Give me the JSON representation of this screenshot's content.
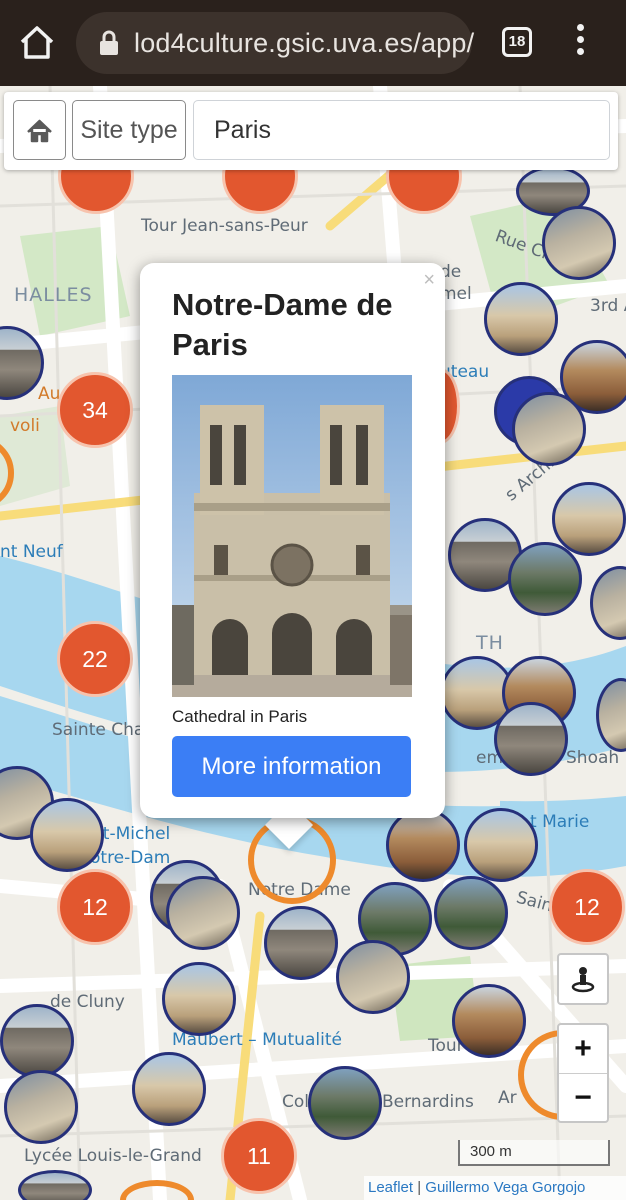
{
  "browser": {
    "url": "lod4culture.gsic.uva.es/app/",
    "tab_count": "18"
  },
  "toolbar": {
    "site_type_label": "Site type",
    "search_value": "Paris"
  },
  "map": {
    "labels": {
      "tour_jean": "Tour Jean-sans-Peur",
      "halles": "HALLES",
      "rue_ch": "Rue Ch",
      "au": "Au",
      "voli": "voli",
      "nt_neuf": "nt Neuf",
      "sainte_cha": "Sainte Cha",
      "notre_dame": "Notre Dame",
      "nt_michel": "nt-Michel",
      "notre_dam": "otre-Dam",
      "de_cluny": "de Cluny",
      "maubert": "Maubert – Mutualité",
      "lycee": "Lycée Louis-le-Grand",
      "bernardins": "Bernardins",
      "col": "Col",
      "t_marie": "t Marie",
      "shoah": "Shoah",
      "memo": "emo",
      "th": "TH",
      "rd": "3rd A",
      "ds_archiv": "s Archiv",
      "de": "de",
      "mel": "mel",
      "uteau": "uteau",
      "sain": "Sain",
      "tour": "Tour",
      "ar": "Ar"
    },
    "clusters": {
      "c34": "34",
      "c22": "22",
      "c12a": "12",
      "c12b": "12",
      "c11": "11"
    },
    "scale": "300 m",
    "attribution_leaflet": "Leaflet",
    "attribution_author": "Guillermo Vega Gorgojo",
    "attribution_sep": " | "
  },
  "popup": {
    "close": "×",
    "title": "Notre-Dame de Paris",
    "description": "Cathedral in Paris",
    "button": "More information"
  },
  "controls": {
    "zoom_in": "+",
    "zoom_out": "−"
  },
  "colors": {
    "cluster": "#e2572f",
    "marker_border": "#26307a",
    "selected_border": "#ee8a2c",
    "button": "#3b7ef5"
  }
}
